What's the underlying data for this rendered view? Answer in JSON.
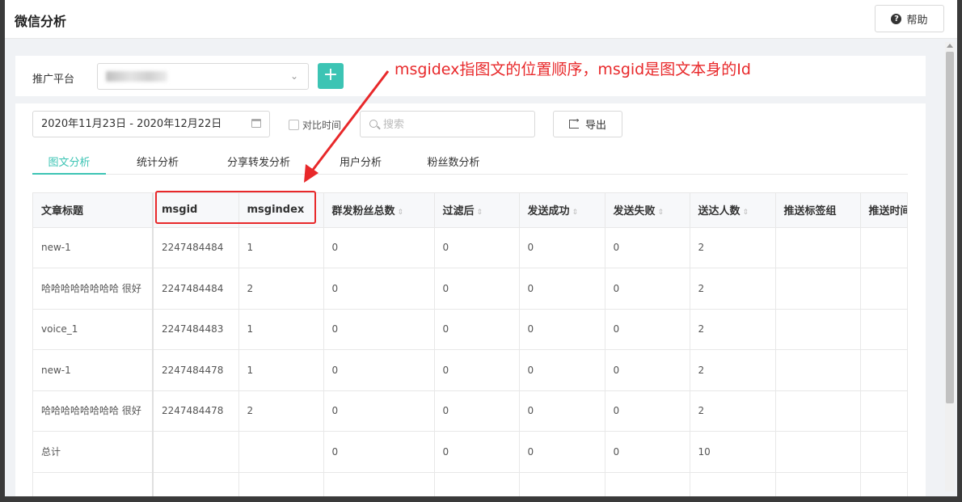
{
  "app_title": "微信分析",
  "help_label": "帮助",
  "platform": {
    "label": "推广平台"
  },
  "toolbar": {
    "date_range": "2020年11月23日 - 2020年12月22日",
    "compare_label": "对比时间",
    "search_placeholder": "搜索",
    "export_label": "导出"
  },
  "tabs": [
    "图文分析",
    "统计分析",
    "分享转发分析",
    "用户分析",
    "粉丝数分析"
  ],
  "active_tab": 0,
  "table": {
    "headers": [
      "文章标题",
      "msgid",
      "msgindex",
      "群发粉丝总数",
      "过滤后",
      "发送成功",
      "发送失败",
      "送达人数",
      "推送标签组",
      "推送时间"
    ],
    "rows": [
      [
        "new-1",
        "2247484484",
        "1",
        "0",
        "0",
        "0",
        "0",
        "2",
        "",
        ""
      ],
      [
        "哈哈哈哈哈哈哈哈 很好",
        "2247484484",
        "2",
        "0",
        "0",
        "0",
        "0",
        "2",
        "",
        ""
      ],
      [
        "voice_1",
        "2247484483",
        "1",
        "0",
        "0",
        "0",
        "0",
        "2",
        "",
        ""
      ],
      [
        "new-1",
        "2247484478",
        "1",
        "0",
        "0",
        "0",
        "0",
        "2",
        "",
        ""
      ],
      [
        "哈哈哈哈哈哈哈哈 很好",
        "2247484478",
        "2",
        "0",
        "0",
        "0",
        "0",
        "2",
        "",
        ""
      ],
      [
        "总计",
        "",
        "",
        "0",
        "0",
        "0",
        "0",
        "10",
        "",
        ""
      ]
    ]
  },
  "annotation": {
    "text": "msgidex指图文的位置顺序，msgid是图文本身的Id",
    "color": "#e8282a"
  },
  "colors": {
    "accent": "#3cc4b4",
    "annotation_red": "#e8282a"
  }
}
